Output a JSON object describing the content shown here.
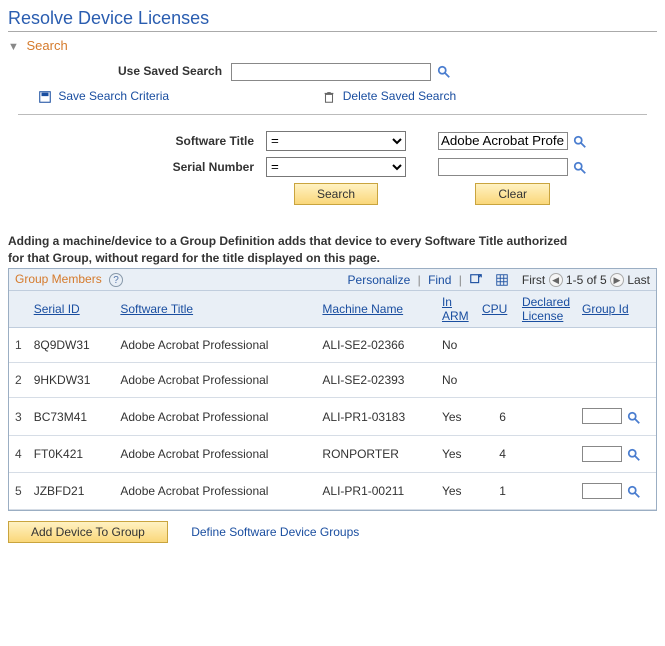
{
  "page": {
    "title": "Resolve Device Licenses"
  },
  "search": {
    "header": "Search",
    "saved_label": "Use Saved Search",
    "saved_value": "",
    "save_criteria_link": "Save Search Criteria",
    "delete_saved_link": "Delete Saved Search",
    "fields": {
      "software_title": {
        "label": "Software Title",
        "op": "=",
        "value": "Adobe Acrobat Profe"
      },
      "serial_number": {
        "label": "Serial Number",
        "op": "=",
        "value": ""
      }
    },
    "buttons": {
      "search": "Search",
      "clear": "Clear"
    }
  },
  "info_line1": "Adding a machine/device to a Group Definition adds that device to every Software Title authorized",
  "info_line2": "for that Group, without regard for the title displayed on this page.",
  "grid": {
    "title": "Group Members",
    "tools": {
      "personalize": "Personalize",
      "find": "Find",
      "first": "First",
      "range": "1-5 of 5",
      "last": "Last"
    },
    "columns": {
      "serial_id": "Serial ID",
      "software_title": "Software Title",
      "machine_name": "Machine Name",
      "in_arm": "In ARM",
      "cpu": "CPU",
      "declared_license": "Declared License",
      "group_id": "Group Id"
    },
    "rows": [
      {
        "n": "1",
        "serial_id": "8Q9DW31",
        "software_title": "Adobe Acrobat Professional",
        "machine_name": "ALI-SE2-02366",
        "in_arm": "No",
        "cpu": "",
        "declared_license": "",
        "group_id": "",
        "group_editable": false
      },
      {
        "n": "2",
        "serial_id": "9HKDW31",
        "software_title": "Adobe Acrobat Professional",
        "machine_name": "ALI-SE2-02393",
        "in_arm": "No",
        "cpu": "",
        "declared_license": "",
        "group_id": "",
        "group_editable": false
      },
      {
        "n": "3",
        "serial_id": "BC73M41",
        "software_title": "Adobe Acrobat Professional",
        "machine_name": "ALI-PR1-03183",
        "in_arm": "Yes",
        "cpu": "6",
        "declared_license": "",
        "group_id": "",
        "group_editable": true
      },
      {
        "n": "4",
        "serial_id": "FT0K421",
        "software_title": "Adobe Acrobat Professional",
        "machine_name": "RONPORTER",
        "in_arm": "Yes",
        "cpu": "4",
        "declared_license": "",
        "group_id": "",
        "group_editable": true
      },
      {
        "n": "5",
        "serial_id": "JZBFD21",
        "software_title": "Adobe Acrobat Professional",
        "machine_name": "ALI-PR1-00211",
        "in_arm": "Yes",
        "cpu": "1",
        "declared_license": "",
        "group_id": "",
        "group_editable": true
      }
    ]
  },
  "bottom": {
    "add_button": "Add Device To Group",
    "define_link": "Define Software Device Groups"
  }
}
